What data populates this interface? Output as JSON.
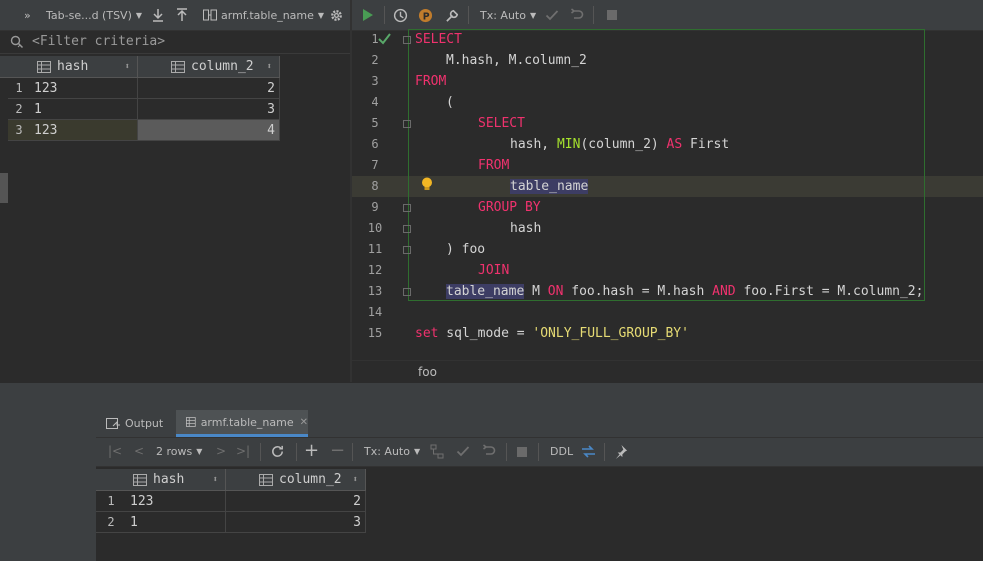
{
  "left_toolbar": {
    "format_label": "Tab-se...d (TSV)",
    "table_label": "armf.table_name"
  },
  "filter": {
    "placeholder": "<Filter criteria>"
  },
  "top_grid": {
    "columns": [
      "hash",
      "column_2"
    ],
    "rows": [
      {
        "num": "1",
        "hash": "123",
        "col2": "2"
      },
      {
        "num": "2",
        "hash": "1",
        "col2": "3"
      },
      {
        "num": "3",
        "hash": "123",
        "col2": "4"
      }
    ]
  },
  "editor_toolbar": {
    "tx_label": "Tx: Auto"
  },
  "editor": {
    "line_numbers": [
      "1",
      "2",
      "3",
      "4",
      "5",
      "6",
      "7",
      "8",
      "9",
      "10",
      "11",
      "12",
      "13",
      "14",
      "15"
    ],
    "breadcrumb": "foo",
    "lines": {
      "l1": "SELECT",
      "l2": "M.hash, M.column_2",
      "l3": "FROM",
      "l4": "(",
      "l5": "SELECT",
      "l6a": "hash, ",
      "l6b": "MIN",
      "l6c": "(column_2) ",
      "l6d": "AS",
      "l6e": " First",
      "l7": "FROM",
      "l8": "table_name",
      "l9": "GROUP BY",
      "l10": "hash",
      "l11": ") foo",
      "l12": "JOIN",
      "l13a": "table_name",
      "l13b": " M ",
      "l13c": "ON",
      "l13d": " foo.hash = M.hash ",
      "l13e": "AND",
      "l13f": " foo.First = M.column_2;",
      "l15a": "set",
      "l15b": " sql_mode = ",
      "l15c": "'ONLY_FULL_GROUP_BY'"
    }
  },
  "bottom_tabs": {
    "output": "Output",
    "table": "armf.table_name"
  },
  "bottom_toolbar": {
    "rows_label": "2 rows",
    "tx_label": "Tx: Auto",
    "ddl_label": "DDL"
  },
  "bottom_grid": {
    "columns": [
      "hash",
      "column_2"
    ],
    "rows": [
      {
        "num": "1",
        "hash": "123",
        "col2": "2"
      },
      {
        "num": "2",
        "hash": "1",
        "col2": "3"
      }
    ]
  }
}
